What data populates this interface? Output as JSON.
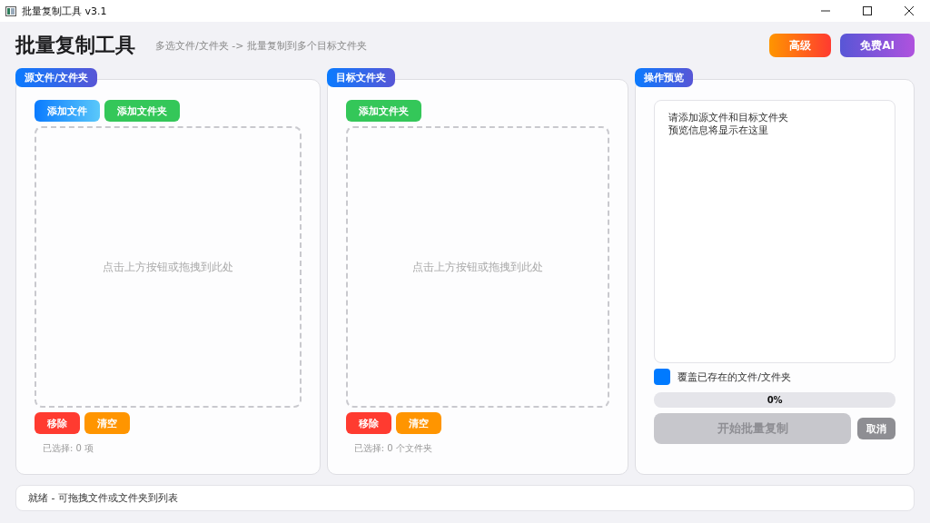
{
  "window": {
    "title": "批量复制工具 v3.1"
  },
  "header": {
    "title": "批量复制工具",
    "subtitle": "多选文件/文件夹 -> 批量复制到多个目标文件夹",
    "buttons": [
      {
        "label": "高级",
        "kind": "sunset"
      },
      {
        "label": "免费AI",
        "kind": "violet"
      }
    ]
  },
  "panels": [
    {
      "label": "源文件/文件夹",
      "top_buttons": [
        {
          "label": "添加文件",
          "kind": "sky"
        },
        {
          "label": "添加文件夹",
          "kind": "green"
        }
      ],
      "drop_hint": "点击上方按钮或拖拽到此处",
      "bottom_buttons": [
        {
          "label": "移除",
          "kind": "red"
        },
        {
          "label": "清空",
          "kind": "orange"
        }
      ],
      "count": "已选择: 0 项"
    },
    {
      "label": "目标文件夹",
      "top_buttons": [
        {
          "label": "添加文件夹",
          "kind": "green"
        }
      ],
      "drop_hint": "点击上方按钮或拖拽到此处",
      "bottom_buttons": [
        {
          "label": "移除",
          "kind": "red"
        },
        {
          "label": "清空",
          "kind": "orange"
        }
      ],
      "count": "已选择: 0 个文件夹"
    }
  ],
  "preview": {
    "label": "操作预览",
    "lines": [
      "请添加源文件和目标文件夹",
      "预览信息将显示在这里"
    ],
    "overwrite": {
      "label": "覆盖已存在的文件/文件夹",
      "checked": true
    },
    "progress": {
      "level": 0,
      "reading": "0%"
    },
    "start_button": {
      "label": "开始批量复制",
      "disabled": true
    },
    "cancel_button": {
      "label": "取消"
    }
  },
  "status_bar": "就绪 - 可拖拽文件或文件夹到列表"
}
